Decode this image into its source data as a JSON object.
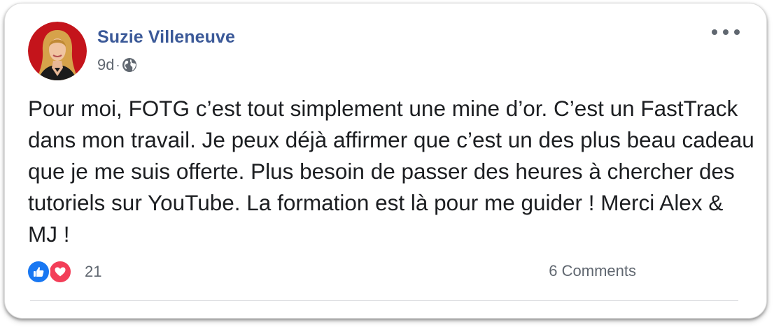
{
  "post": {
    "author": "Suzie Villeneuve",
    "time": "9d",
    "separator": "·",
    "text_before": "Pour moi, ",
    "text_highlight": "FOTG c’est tout simplement une mine d’or.",
    "text_after": " C’est un FastTrack dans mon travail. Je peux déjà affirmer que c’est un des plus beau cadeau que je me suis offerte. Plus besoin de passer des heures à chercher des tutoriels sur YouTube. La formation est là pour me guider ! Merci Alex & MJ !",
    "reaction_count": "21",
    "comments": "6 Comments"
  },
  "icons": {
    "privacy": "globe-icon",
    "more": "more-options-icon",
    "reactions": [
      "like-icon",
      "love-icon"
    ]
  },
  "colors": {
    "author": "#3b5998",
    "highlight": "#f6e93a",
    "like": "#1877f2",
    "love": "#f33e58",
    "secondary_text": "#606770"
  }
}
